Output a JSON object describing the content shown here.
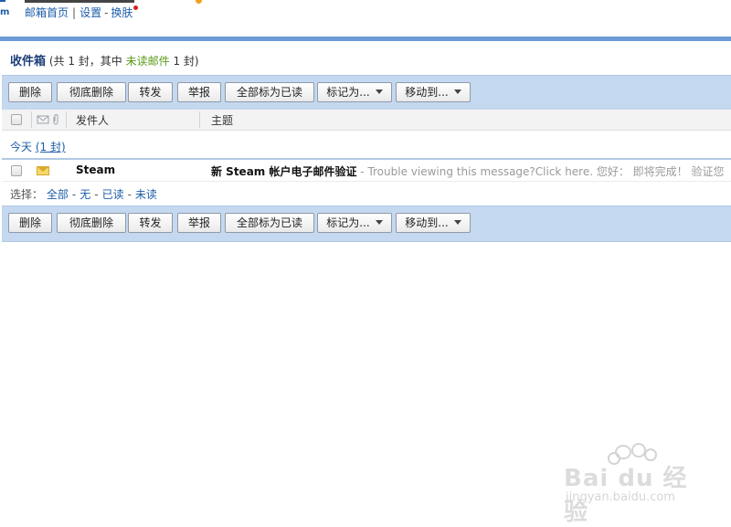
{
  "top": {
    "links": [
      "邮箱首页",
      "设置",
      "换肤"
    ]
  },
  "inbox": {
    "title": "收件箱",
    "meta_prefix": "(共 1 封，其中 ",
    "unread_label": "未读邮件",
    "meta_suffix": " 1 封)"
  },
  "toolbar": {
    "delete": "删除",
    "delete_forever": "彻底删除",
    "forward": "转发",
    "report": "举报",
    "mark_all_read": "全部标为已读",
    "mark_as": "标记为...",
    "move_to": "移动到..."
  },
  "columns": {
    "sender": "发件人",
    "subject": "主题"
  },
  "group": {
    "label": "今天",
    "count": "(1 封)"
  },
  "messages": [
    {
      "sender": "Steam",
      "subject": "新 Steam 帐户电子邮件验证",
      "preview": " - Trouble viewing this message?Click here. 您好： 即将完成！ 验证您"
    }
  ],
  "select": {
    "label": "选择：",
    "all": "全部",
    "none": "无",
    "read": "已读",
    "unread": "未读"
  },
  "watermark": {
    "text": "Bai du 经验",
    "sub": "jingyan.baidu.com"
  },
  "colors": {
    "accent_blue": "#1d5da9",
    "toolbar_bg": "#c4d8ef",
    "unread_green": "#5a9b17"
  }
}
